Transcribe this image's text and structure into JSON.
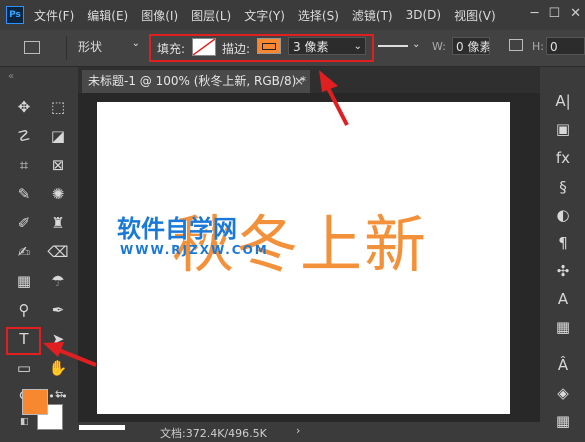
{
  "app": {
    "logo": "Ps"
  },
  "menu": [
    "文件(F)",
    "编辑(E)",
    "图像(I)",
    "图层(L)",
    "文字(Y)",
    "选择(S)",
    "滤镜(T)",
    "3D(D)",
    "视图(V)"
  ],
  "window_controls": {
    "minimize": "─",
    "maximize": "☐",
    "close": "✕"
  },
  "options": {
    "mode": "形状",
    "fill_label": "填充:",
    "stroke_label": "描边:",
    "stroke_width": "3 像素",
    "w_label": "W:",
    "w_value": "0 像素",
    "h_label": "H:",
    "h_value": "0",
    "fill_color": "#ffffff",
    "stroke_color": "#f7882f"
  },
  "tab": {
    "title": "未标题-1 @ 100% (秋冬上新, RGB/8) *",
    "close": "×"
  },
  "canvas": {
    "text": "秋冬上新",
    "text_color": "#f3913a",
    "watermark": "软件自学网",
    "watermark_sub": "WWW.RJZXW.COM"
  },
  "status": {
    "doc_info": "文档:372.4K/496.5K",
    "arrow": "›"
  },
  "toolbox": {
    "head": "«",
    "foreground": "#f7882f",
    "background": "#ffffff",
    "tools": [
      {
        "name": "move-tool",
        "glyph": "✥"
      },
      {
        "name": "marquee-tool",
        "glyph": "⬚"
      },
      {
        "name": "lasso-tool",
        "glyph": "☡"
      },
      {
        "name": "quick-select-tool",
        "glyph": "◪"
      },
      {
        "name": "crop-tool",
        "glyph": "⌗"
      },
      {
        "name": "frame-tool",
        "glyph": "⊠"
      },
      {
        "name": "eyedropper-tool",
        "glyph": "✎"
      },
      {
        "name": "spot-heal-tool",
        "glyph": "✺"
      },
      {
        "name": "brush-tool",
        "glyph": "✐"
      },
      {
        "name": "stamp-tool",
        "glyph": "♜"
      },
      {
        "name": "history-brush-tool",
        "glyph": "✍"
      },
      {
        "name": "eraser-tool",
        "glyph": "⌫"
      },
      {
        "name": "gradient-tool",
        "glyph": "▦"
      },
      {
        "name": "blur-tool",
        "glyph": "☂"
      },
      {
        "name": "dodge-tool",
        "glyph": "⚲"
      },
      {
        "name": "pen-tool",
        "glyph": "✒"
      },
      {
        "name": "type-tool",
        "glyph": "T"
      },
      {
        "name": "path-select-tool",
        "glyph": "➤"
      },
      {
        "name": "rectangle-tool",
        "glyph": "▭"
      },
      {
        "name": "hand-tool",
        "glyph": "✋"
      },
      {
        "name": "zoom-tool",
        "glyph": "⚲"
      },
      {
        "name": "more-tools",
        "glyph": "•••"
      }
    ]
  },
  "panels": [
    {
      "name": "character-panel-icon",
      "glyph": "A|"
    },
    {
      "name": "swatches-panel-icon",
      "glyph": "▣"
    },
    {
      "name": "styles-panel-icon",
      "glyph": "fx"
    },
    {
      "name": "libraries-panel-icon",
      "glyph": "§"
    },
    {
      "name": "color-panel-icon",
      "glyph": "◐"
    },
    {
      "name": "paragraph-panel-icon",
      "glyph": "¶"
    },
    {
      "name": "brush-settings-icon",
      "glyph": "✣"
    },
    {
      "name": "glyphs-panel-icon",
      "glyph": "A"
    },
    {
      "name": "table-panel-icon",
      "glyph": "▦"
    },
    {
      "name": "3d-panel-icon",
      "glyph": "Â"
    },
    {
      "name": "layers-panel-icon",
      "glyph": "◈"
    },
    {
      "name": "channels-panel-icon",
      "glyph": "▦"
    }
  ]
}
